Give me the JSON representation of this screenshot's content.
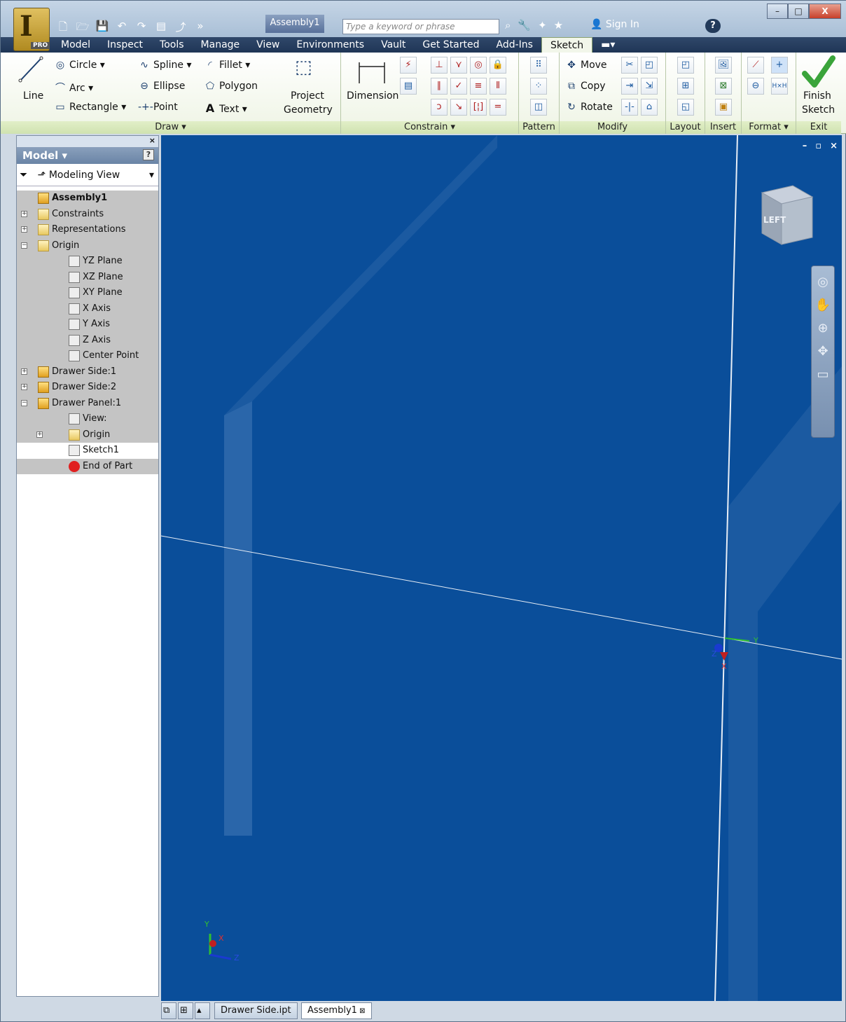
{
  "window": {
    "app_menu_glyph": "I",
    "edition_badge": "PRO",
    "document_title": "Assembly1",
    "search_placeholder": "Type a keyword or phrase",
    "sign_in": "Sign In",
    "help_glyph": "?",
    "controls": {
      "minimize": "–",
      "restore": "□",
      "close": "X"
    }
  },
  "tabs": [
    {
      "label": "Model",
      "active": false
    },
    {
      "label": "Inspect",
      "active": false
    },
    {
      "label": "Tools",
      "active": false
    },
    {
      "label": "Manage",
      "active": false
    },
    {
      "label": "View",
      "active": false
    },
    {
      "label": "Environments",
      "active": false
    },
    {
      "label": "Vault",
      "active": false
    },
    {
      "label": "Get Started",
      "active": false
    },
    {
      "label": "Add-Ins",
      "active": false
    },
    {
      "label": "Sketch",
      "active": true
    }
  ],
  "ribbon": {
    "draw": {
      "label": "Draw ▾",
      "line": "Line",
      "circle": "Circle ▾",
      "arc": "Arc ▾",
      "rectangle": "Rectangle ▾",
      "spline": "Spline ▾",
      "ellipse": "Ellipse",
      "point": "Point",
      "fillet": "Fillet ▾",
      "polygon": "Polygon",
      "text": "Text ▾",
      "project_geometry_1": "Project",
      "project_geometry_2": "Geometry"
    },
    "constrain": {
      "label": "Constrain ▾",
      "dimension": "Dimension"
    },
    "pattern": {
      "label": "Pattern"
    },
    "modify": {
      "label": "Modify",
      "move": "Move",
      "copy": "Copy",
      "rotate": "Rotate"
    },
    "layout": {
      "label": "Layout"
    },
    "insert": {
      "label": "Insert"
    },
    "format": {
      "label": "Format ▾"
    },
    "exit": {
      "label": "Exit",
      "finish_1": "Finish",
      "finish_2": "Sketch"
    }
  },
  "browser": {
    "header": "Model ▾",
    "view_mode": "Modeling View",
    "tree": [
      {
        "label": "Assembly1",
        "bold": true,
        "indent": 0,
        "icon": "assembly-icon",
        "toggle": ""
      },
      {
        "label": "Constraints",
        "indent": 0,
        "icon": "folder-icon",
        "toggle": "+"
      },
      {
        "label": "Representations",
        "indent": 0,
        "icon": "representations-icon",
        "toggle": "+"
      },
      {
        "label": "Origin",
        "indent": 0,
        "icon": "folder-open-icon",
        "toggle": "−"
      },
      {
        "label": "YZ Plane",
        "indent": 1,
        "icon": "plane-icon",
        "toggle": ""
      },
      {
        "label": "XZ Plane",
        "indent": 1,
        "icon": "plane-icon",
        "toggle": ""
      },
      {
        "label": "XY Plane",
        "indent": 1,
        "icon": "plane-icon",
        "toggle": ""
      },
      {
        "label": "X Axis",
        "indent": 1,
        "icon": "axis-icon",
        "toggle": ""
      },
      {
        "label": "Y Axis",
        "indent": 1,
        "icon": "axis-icon",
        "toggle": ""
      },
      {
        "label": "Z Axis",
        "indent": 1,
        "icon": "axis-icon",
        "toggle": ""
      },
      {
        "label": "Center Point",
        "indent": 1,
        "icon": "center-point-icon",
        "toggle": ""
      },
      {
        "label": "Drawer Side:1",
        "indent": 0,
        "icon": "part-icon",
        "toggle": "+"
      },
      {
        "label": "Drawer Side:2",
        "indent": 0,
        "icon": "part-icon",
        "toggle": "+"
      },
      {
        "label": "Drawer Panel:1",
        "indent": 0,
        "icon": "part-icon",
        "toggle": "−"
      },
      {
        "label": "View:",
        "indent": 1,
        "icon": "view-icon",
        "toggle": ""
      },
      {
        "label": "Origin",
        "indent": 1,
        "icon": "folder-icon",
        "toggle": "+"
      },
      {
        "label": "Sketch1",
        "indent": 1,
        "icon": "sketch-icon",
        "toggle": "",
        "selected": true
      },
      {
        "label": "End of Part",
        "indent": 1,
        "icon": "end-of-part-icon",
        "toggle": ""
      }
    ]
  },
  "viewcube_face": "LEFT",
  "triad": {
    "y": "Y",
    "x": "X",
    "z": "Z"
  },
  "document_tabs": [
    {
      "label": "Drawer Side.ipt",
      "active": false
    },
    {
      "label": "Assembly1",
      "active": true
    }
  ],
  "colors": {
    "viewport": "#0a4e9a",
    "ribbon_group": "#cfe2b0",
    "tab_active": "#f2f6ea"
  }
}
